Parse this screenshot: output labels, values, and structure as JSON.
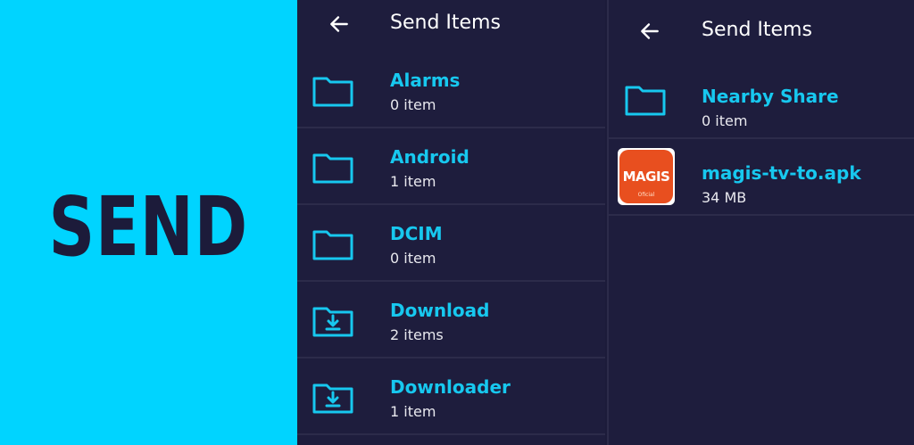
{
  "banner": {
    "title": "SEND"
  },
  "left_panel": {
    "title": "Send Items",
    "items": [
      {
        "name": "Alarms",
        "meta": "0 item",
        "icon": "folder-icon"
      },
      {
        "name": "Android",
        "meta": "1 item",
        "icon": "folder-icon"
      },
      {
        "name": "DCIM",
        "meta": "0 item",
        "icon": "folder-icon"
      },
      {
        "name": "Download",
        "meta": "2 items",
        "icon": "download-folder-icon"
      },
      {
        "name": "Downloader",
        "meta": "1 item",
        "icon": "download-folder-icon"
      }
    ]
  },
  "right_panel": {
    "title": "Send Items",
    "items": [
      {
        "name": "Nearby Share",
        "meta": "0 item",
        "icon": "folder-icon"
      },
      {
        "name": "magis-tv-to.apk",
        "meta": "34 MB",
        "icon": "apk-app-icon",
        "app_icon_text": "MAGIS",
        "app_icon_sub": "Oficial"
      }
    ]
  },
  "colors": {
    "banner_bg": "#00d4ff",
    "panel_bg": "#1e1d3d",
    "accent": "#17c8ef",
    "text": "#ffffff"
  }
}
